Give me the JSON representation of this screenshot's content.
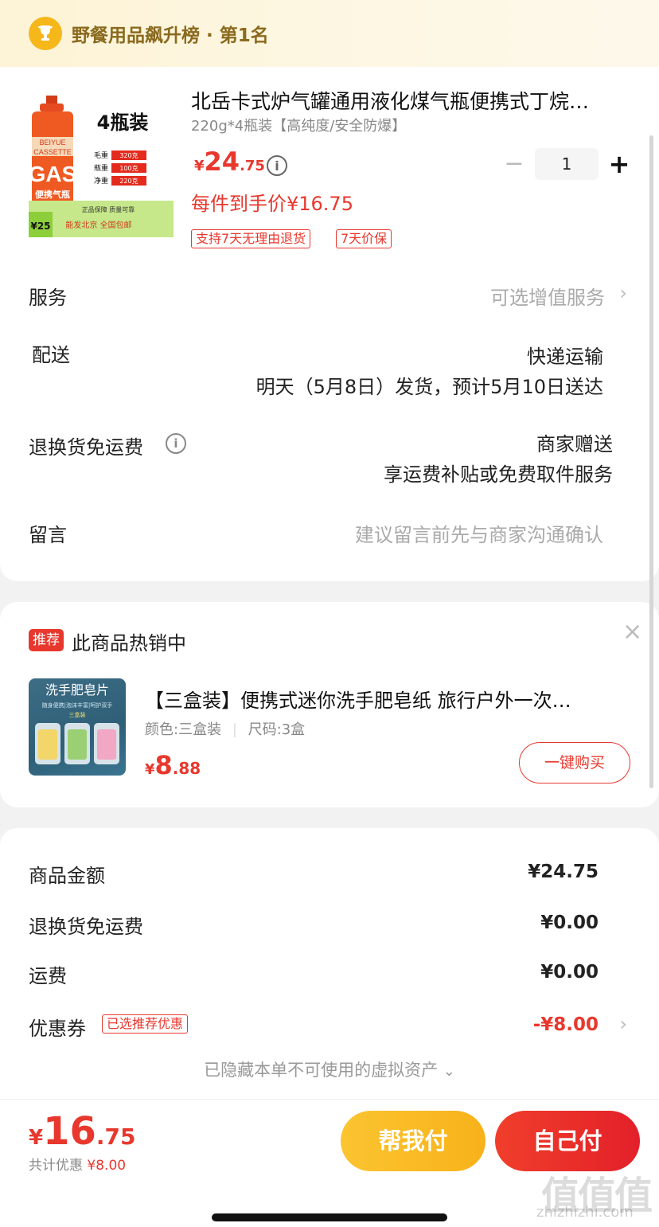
{
  "rank": {
    "icon": "trophy-icon",
    "text": "野餐用品飙升榜 · 第1名"
  },
  "product": {
    "title": "北岳卡式炉气罐通用液化煤气瓶便携式丁烷…",
    "spec": "220g*4瓶装【高纯度/安全防爆】",
    "price_yen": "¥",
    "price_int": "24",
    "price_dec": ".75",
    "unit_price": "每件到手价¥16.75",
    "quantity": "1",
    "tags": [
      "支持7天无理由退货",
      "7天价保"
    ],
    "image_text": {
      "brand": "BEIYUE",
      "pack": "4瓶装",
      "cassette": "CASSETTE",
      "gas": "GAS",
      "portable": "便携气瓶",
      "weights": [
        {
          "label": "毛重",
          "value": "320克"
        },
        {
          "label": "瓶重",
          "value": "100克"
        },
        {
          "label": "净重",
          "value": "220克"
        }
      ],
      "promo_price": "¥25",
      "promo_line1": "能发北京 全国包邮",
      "promo_line2": "正品保障 质量可靠"
    }
  },
  "rows": {
    "service_label": "服务",
    "service_value": "可选增值服务",
    "delivery_label": "配送",
    "delivery_method": "快递运输",
    "delivery_time": "明天（5月8日）发货，预计5月10日送达",
    "return_label": "退换货免运费",
    "return_value1": "商家赠送",
    "return_value2": "享运费补贴或免费取件服务",
    "message_label": "留言",
    "message_placeholder": "建议留言前先与商家沟通确认"
  },
  "recommend": {
    "badge": "推荐",
    "title": "此商品热销中",
    "item_name": "【三盒装】便携式迷你洗手肥皂纸 旅行户外一次…",
    "item_spec_color": "颜色:三盒装",
    "item_spec_size": "尺码:3盒",
    "price_yen": "¥",
    "price_int": "8",
    "price_dec": ".88",
    "buy_label": "一键购买",
    "image_title": "洗手肥皂片",
    "image_sub": "随身便携|泡沫丰富|呵护双手",
    "image_pack": "三盒装"
  },
  "summary": {
    "goods_label": "商品金额",
    "goods_value": "¥24.75",
    "return_label": "退换货免运费",
    "return_value": "¥0.00",
    "shipping_label": "运费",
    "shipping_value": "¥0.00",
    "coupon_label": "优惠券",
    "coupon_tag": "已选推荐优惠",
    "coupon_value": "-¥8.00",
    "hidden_note": "已隐藏本单不可使用的虚拟资产"
  },
  "footer": {
    "total_yen": "¥",
    "total_int": "16",
    "total_dec": ".75",
    "discount_label": "共计优惠",
    "discount_value": "¥8.00",
    "help_pay": "帮我付",
    "self_pay": "自己付"
  },
  "watermark": {
    "text": "值值值",
    "sub": "zhizhizhi.com"
  },
  "colors": {
    "accent": "#e8382e",
    "gold": "#f8b21a",
    "rank_text": "#8a6a1e"
  }
}
